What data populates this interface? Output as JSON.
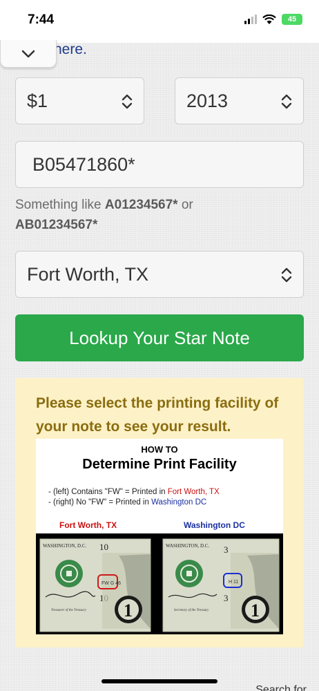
{
  "status": {
    "time": "7:44",
    "battery": "45"
  },
  "header": {
    "partial_link_text": "here."
  },
  "form": {
    "denomination": {
      "selected": "$1"
    },
    "series": {
      "selected": "2013"
    },
    "serial": {
      "value": "B05471860*"
    },
    "hint": {
      "prefix": "Something like ",
      "example1": "A01234567*",
      "or": " or",
      "example2": "AB01234567*"
    },
    "facility": {
      "selected": "Fort Worth, TX"
    },
    "lookup_button": "Lookup Your Star Note"
  },
  "result": {
    "message": "Please select the printing facility of your note to see your result.",
    "infographic": {
      "how_to": "HOW TO",
      "title": "Determine Print Facility",
      "line1_prefix": "- (left) Contains \"FW\" = Printed in ",
      "line1_place": "Fort Worth, TX",
      "line2_prefix": "- (right) No \"FW\" = Printed in ",
      "line2_place": "Washington DC",
      "label_left": "Fort Worth, TX",
      "label_right": "Washington DC",
      "bill_left": {
        "city": "WASHINGTON, D.C.",
        "number": "10",
        "mark": "FW G 46",
        "sig_text": "Treasurer of the Treasury",
        "digit": "1"
      },
      "bill_right": {
        "city": "WASHINGTON, D.C.",
        "number": "3",
        "mark": "H 11",
        "sig_text": "Secretary of the Treasury",
        "digit": "1"
      }
    }
  },
  "footer": {
    "search_peek": "Search for"
  },
  "colors": {
    "accent_green": "#2aa84a",
    "link_blue": "#1f3b8a",
    "panel_bg": "#fdf1c7",
    "panel_text": "#8a6d10",
    "fw_red": "#cc1010",
    "dc_blue": "#1a2fa0"
  },
  "icons": {
    "collapse": "chevron-down-icon",
    "select": "up-down-chevron-icon",
    "wifi": "wifi-icon",
    "signal": "cellular-signal-icon"
  }
}
